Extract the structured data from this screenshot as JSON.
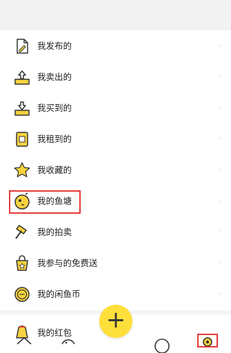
{
  "menu": {
    "items": [
      {
        "label": "我发布的",
        "icon": "document-edit-icon"
      },
      {
        "label": "我卖出的",
        "icon": "sell-upload-icon"
      },
      {
        "label": "我买到的",
        "icon": "buy-download-icon"
      },
      {
        "label": "我租到的",
        "icon": "rent-tag-icon"
      },
      {
        "label": "我收藏的",
        "icon": "star-icon"
      },
      {
        "label": "我的鱼塘",
        "icon": "fish-pond-icon"
      },
      {
        "label": "我的拍卖",
        "icon": "auction-hammer-icon"
      },
      {
        "label": "我参与的免费送",
        "icon": "free-gift-bag-icon"
      },
      {
        "label": "我的闲鱼币",
        "icon": "coin-icon"
      }
    ],
    "chevron": "›"
  },
  "partial_item": {
    "label": "我的红包",
    "icon": "red-packet-icon"
  },
  "tabbar": {
    "publish_symbol": "+",
    "tabs": [
      "home-icon",
      "fish-icon",
      "message-icon",
      "profile-icon"
    ]
  },
  "colors": {
    "accent_yellow": "#ffe03a",
    "icon_yellow": "#f7d23e",
    "highlight_red": "#e53935"
  }
}
